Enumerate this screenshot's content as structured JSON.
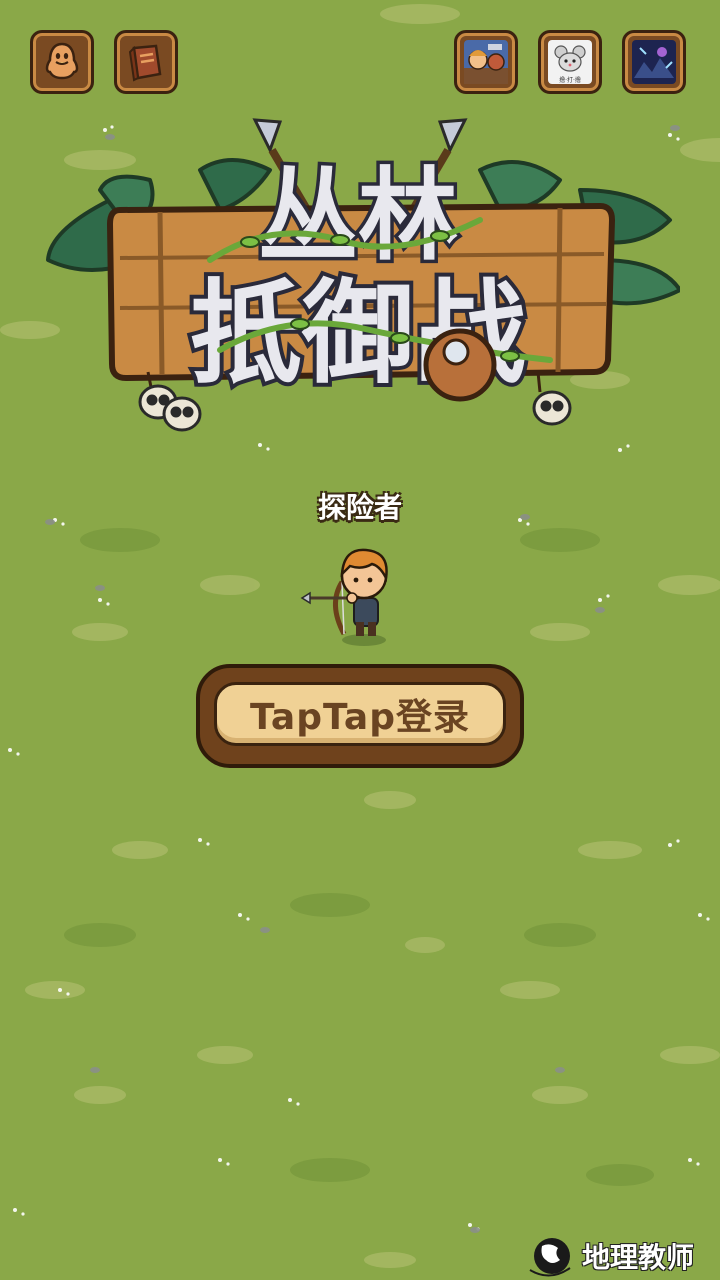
{
  "top_left_buttons": [
    {
      "icon": "qq-penguin-icon"
    },
    {
      "icon": "book-icon"
    }
  ],
  "top_right_buttons": [
    {
      "icon": "game-promo-hero-icon"
    },
    {
      "icon": "game-promo-mouse-icon",
      "caption": "撸·打·撸"
    },
    {
      "icon": "game-promo-dark-icon"
    }
  ],
  "logo": {
    "line1": "丛林",
    "line2": "抵御战"
  },
  "player": {
    "name": "探险者"
  },
  "login": {
    "label": "TapTap登录"
  },
  "watermark": {
    "text": "地理教师"
  },
  "colors": {
    "grass": "#8aa848",
    "wood": "#c98a44",
    "button_face": "#f0d195",
    "button_text": "#6a4422"
  }
}
